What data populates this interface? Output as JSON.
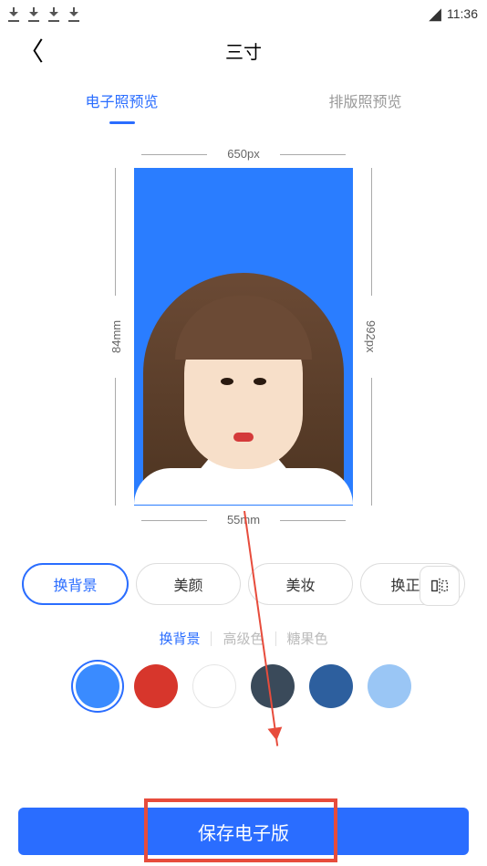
{
  "status": {
    "time": "11:36"
  },
  "header": {
    "title": "三寸"
  },
  "tabs": {
    "digital": "电子照预览",
    "print": "排版照预览"
  },
  "dimensions": {
    "width_px": "650px",
    "height_px": "992px",
    "width_mm": "55mm",
    "height_mm": "84mm"
  },
  "options": {
    "bg": "换背景",
    "beauty": "美颜",
    "makeup": "美妆",
    "outfit": "换正装"
  },
  "subtabs": {
    "bg": "换背景",
    "advanced": "高级色",
    "candy": "糖果色"
  },
  "swatches": {
    "c0": "#3a8bff",
    "c1": "#d7362c",
    "c2": "#ffffff",
    "c3": "#3a4a5a",
    "c4": "#2d5f9e",
    "c5": "#9ac6f5"
  },
  "save_button": "保存电子版"
}
